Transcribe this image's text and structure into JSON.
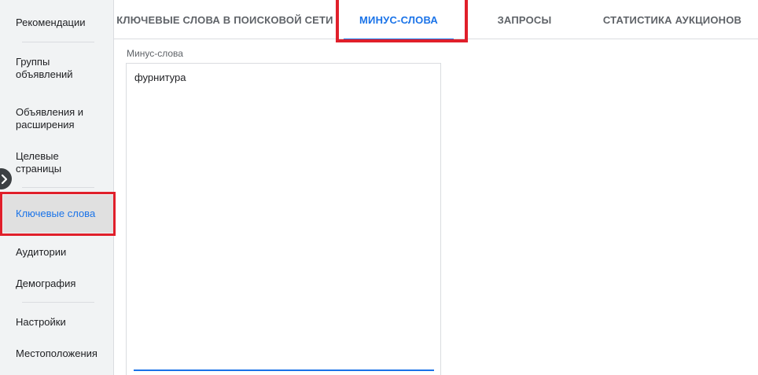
{
  "sidebar": {
    "items": [
      {
        "label": "Рекомендации"
      },
      {
        "label": "Группы объявлений"
      },
      {
        "label": "Объявления и расширения"
      },
      {
        "label": "Целевые страницы"
      },
      {
        "label": "Ключевые слова"
      },
      {
        "label": "Аудитории"
      },
      {
        "label": "Демография"
      },
      {
        "label": "Настройки"
      },
      {
        "label": "Местоположения"
      }
    ],
    "active_item": "Ключевые слова",
    "expand_icon": "chevron-right-icon"
  },
  "tabs": [
    {
      "label": "КЛЮЧЕВЫЕ СЛОВА В ПОИСКОВОЙ СЕТИ"
    },
    {
      "label": "МИНУС-СЛОВА"
    },
    {
      "label": "ЗАПРОСЫ"
    },
    {
      "label": "СТАТИСТИКА АУКЦИОНОВ"
    }
  ],
  "active_tab": "МИНУС-СЛОВА",
  "negative_keywords": {
    "label": "Минус-слова",
    "value": "фурнитура"
  },
  "colors": {
    "accent": "#1a73e8",
    "highlight": "#e01f2a",
    "sidebar_bg": "#f1f3f4"
  }
}
